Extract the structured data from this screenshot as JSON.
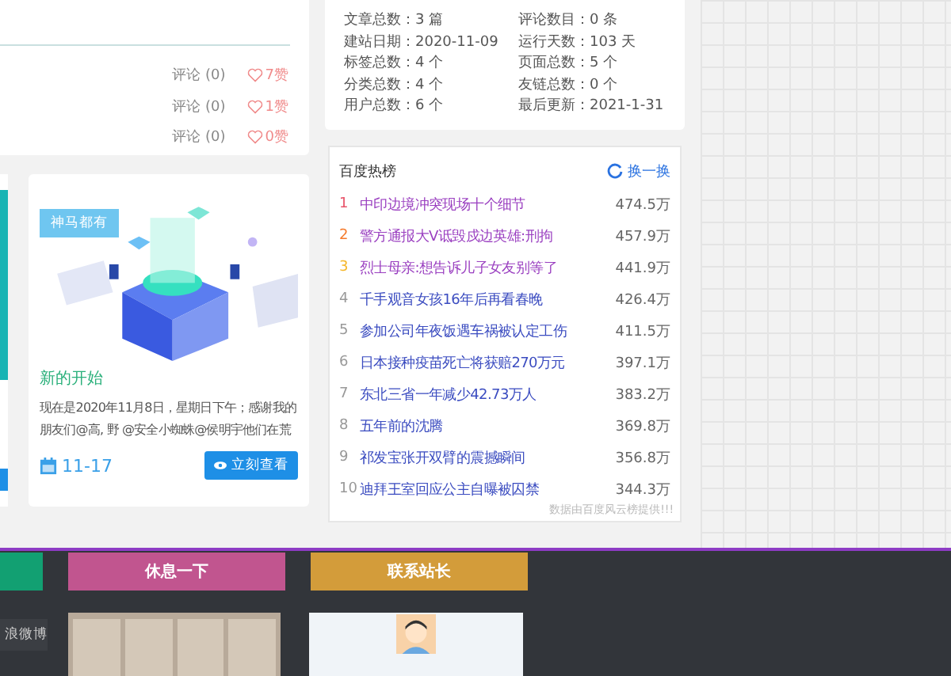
{
  "comment_rows": [
    {
      "comments": "评论 (0)",
      "likes": "7赞"
    },
    {
      "comments": "评论 (0)",
      "likes": "1赞"
    },
    {
      "comments": "评论 (0)",
      "likes": "0赞"
    }
  ],
  "site_stats": [
    {
      "label": "文章总数：",
      "value": "3 篇"
    },
    {
      "label": "评论数目：",
      "value": "0 条"
    },
    {
      "label": "建站日期：",
      "value": "2020-11-09"
    },
    {
      "label": "运行天数：",
      "value": "103 天"
    },
    {
      "label": "标签总数：",
      "value": "4 个"
    },
    {
      "label": "页面总数：",
      "value": "5 个"
    },
    {
      "label": "分类总数：",
      "value": "4 个"
    },
    {
      "label": "友链总数：",
      "value": "0 个"
    },
    {
      "label": "用户总数：",
      "value": "6 个"
    },
    {
      "label": "最后更新：",
      "value": "2021-1-31"
    }
  ],
  "post_card": {
    "tag": "神马都有",
    "title": "新的开始",
    "excerpt": "现在是2020年11月8日，星期日下午；感谢我的朋友们@高, 野 @安全小蜘蛛@侯明宇他们在荒",
    "date": "11-17",
    "button": "立刻查看"
  },
  "hot_list": {
    "title": "百度热榜",
    "refresh": "换一换",
    "footnote": "数据由百度风云榜提供!!!",
    "items": [
      {
        "rank": "1",
        "color": "#e8546a",
        "title": "中印边境冲突现场十个细节",
        "visited": true,
        "heat": "474.5万"
      },
      {
        "rank": "2",
        "color": "#f57a2c",
        "title": "警方通报大V诋毁戍边英雄:刑拘",
        "visited": true,
        "heat": "457.9万"
      },
      {
        "rank": "3",
        "color": "#f5b72c",
        "title": "烈士母亲:想告诉儿子女友别等了",
        "visited": true,
        "heat": "441.9万"
      },
      {
        "rank": "4",
        "color": "#999999",
        "title": "千手观音女孩16年后再看春晚",
        "visited": false,
        "heat": "426.4万"
      },
      {
        "rank": "5",
        "color": "#999999",
        "title": "参加公司年夜饭遇车祸被认定工伤",
        "visited": false,
        "heat": "411.5万"
      },
      {
        "rank": "6",
        "color": "#999999",
        "title": "日本接种疫苗死亡将获赔270万元",
        "visited": false,
        "heat": "397.1万"
      },
      {
        "rank": "7",
        "color": "#999999",
        "title": "东北三省一年减少42.73万人",
        "visited": false,
        "heat": "383.2万"
      },
      {
        "rank": "8",
        "color": "#999999",
        "title": "五年前的沈腾",
        "visited": false,
        "heat": "369.8万"
      },
      {
        "rank": "9",
        "color": "#999999",
        "title": "祁发宝张开双臂的震撼瞬间",
        "visited": false,
        "heat": "356.8万"
      },
      {
        "rank": "10",
        "color": "#999999",
        "title": "迪拜王室回应公主自曝被囚禁",
        "visited": false,
        "heat": "344.3万"
      }
    ]
  },
  "footer": {
    "tabs": [
      {
        "label": "休息一下",
        "color": "#c1558f"
      },
      {
        "label": "联系站长",
        "color": "#d39c3a"
      }
    ],
    "weibo": "浪微博"
  }
}
